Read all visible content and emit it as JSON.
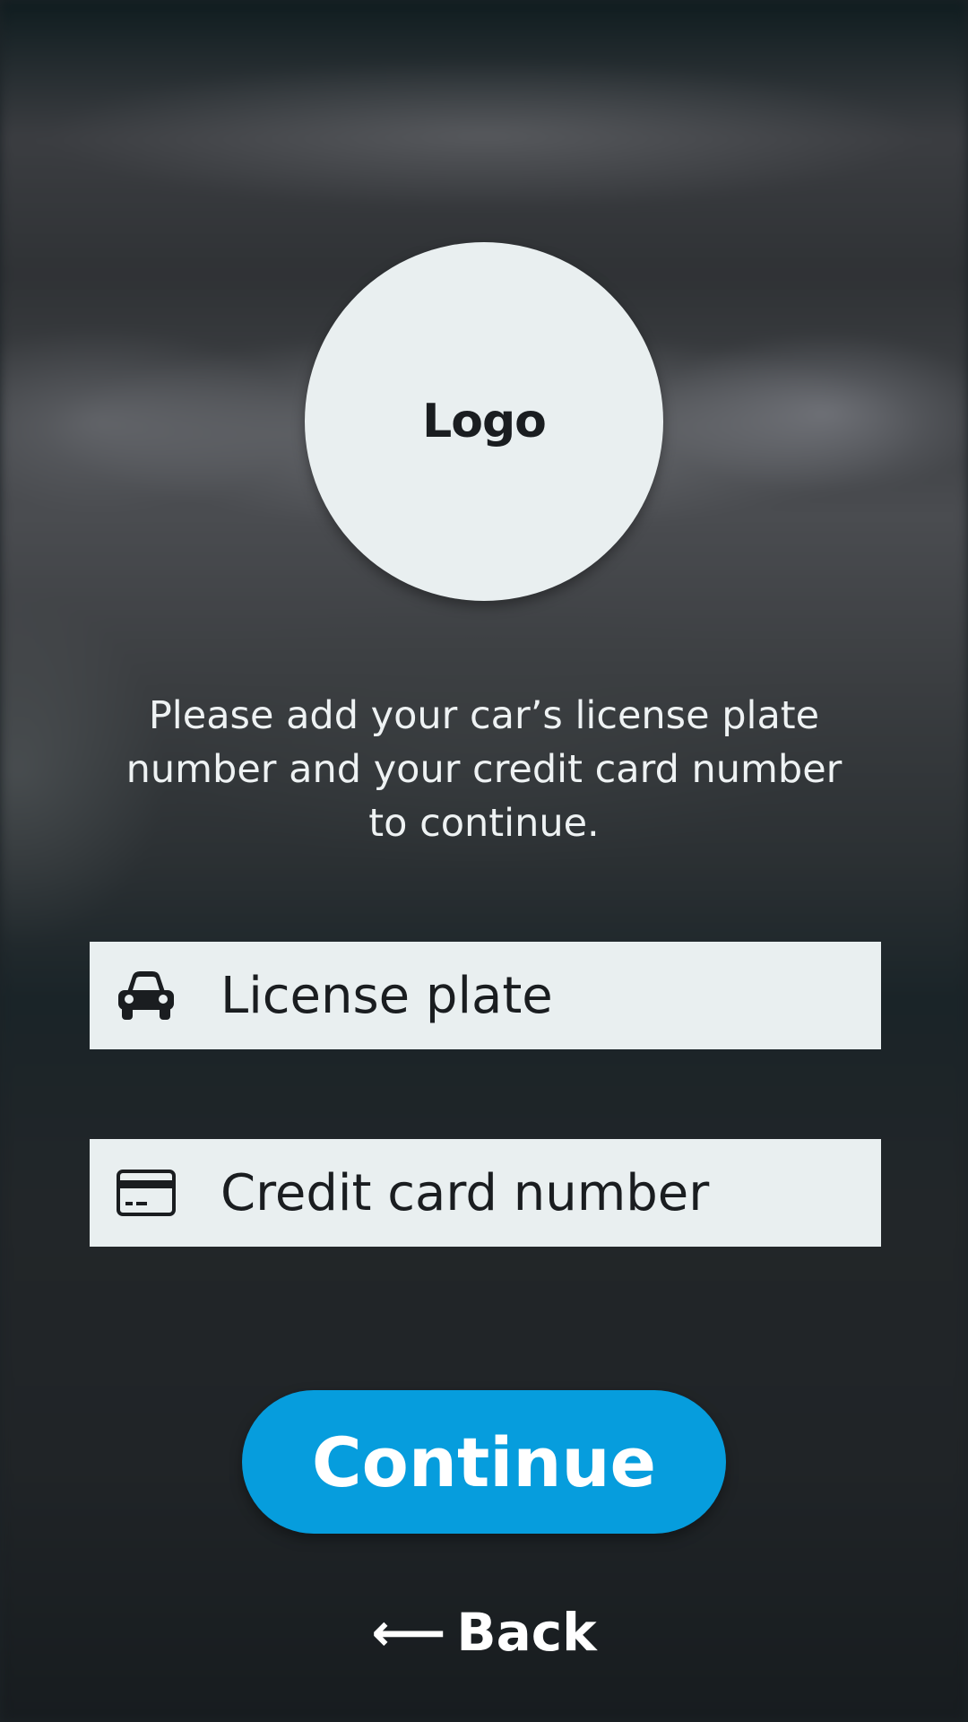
{
  "logo": {
    "label": "Logo"
  },
  "instructions": "Please add your car’s license plate number and your credit card number to continue.",
  "form": {
    "license_plate": {
      "placeholder": "License plate",
      "value": "",
      "icon": "car-icon"
    },
    "credit_card": {
      "placeholder": "Credit card number",
      "value": "",
      "icon": "credit-card-icon"
    }
  },
  "actions": {
    "continue_label": "Continue",
    "back_label": "Back",
    "back_icon": "arrow-left-icon"
  },
  "colors": {
    "accent": "#069ddd",
    "field_bg": "#e9eff0",
    "text_dark": "#1a1d20"
  }
}
